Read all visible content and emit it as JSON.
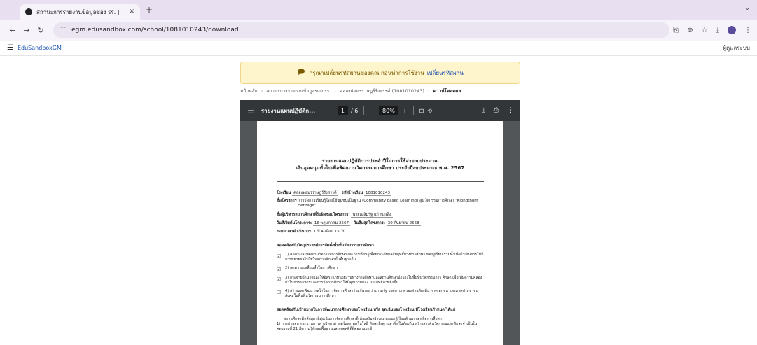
{
  "browser": {
    "tab_title": "สถานะการรายงานข้อมูลของ รร. |",
    "url": "egm.edusandbox.com/school/1081010243/download"
  },
  "app": {
    "brand": "EduSandboxGM",
    "user_menu": "ผู้ดูแลระบบ"
  },
  "notice": {
    "text": "กรุณาเปลี่ยนรหัสผ่านของคุณ ก่อนทำการใช้งาน",
    "link": "เปลี่ยนรหัสผ่าน"
  },
  "breadcrumb": [
    "หน้าหลัก",
    "สถานะการรายงานข้อมูลของ รร.",
    "คลองพ่อมรราษฎร์รังสรรค์ (1081010243)",
    "ดาวน์โหลดผล"
  ],
  "viewer": {
    "doc_title": "รายงานแผนปฏิบัติก...",
    "page_current": "1",
    "page_sep": "/",
    "page_total": "6",
    "zoom": "80%"
  },
  "doc": {
    "title_line1": "รายงานแผนปฏิบัติการประจำปีในการใช้จ่ายงบประมาณ",
    "title_line2": "เงินอุดหนุนทั่วไปเพื่อพัฒนานวัตกรรมการศึกษา ประจำปีงบประมาณ พ.ศ. 2567",
    "school_label": "โรงเรียน",
    "school_value": "คลองพ่อมรราษฎร์รังสรรค์",
    "code_label": "รหัสโรงเรียน",
    "code_value": "1081010243",
    "project_label": "ชื่อโครงการ",
    "project_value": "การจัดการเรียนรู้โดยใช้ชุมชนเป็นฐาน (Community based Learning) สู่นวัตกรรมการศึกษา \"Klongthom Heritage\"",
    "admin_label": "ชื่อผู้บริหารสถานศึกษาที่รับผิดชอบโครงการ:",
    "admin_value": "นายเฉลิมรัฐ แก้วนาเส็ง",
    "start_label": "วันที่เริ่มต้นโครงการ:",
    "start_value": "16 พฤษภาคม 2567",
    "end_label": "วันสิ้นสุดโครงการ:",
    "end_value": "30 กันยายน 2568",
    "duration_label": "ระยะเวลาดำเนินการ",
    "duration_value": "1 ปี 4 เดือน 15 วัน",
    "section1": "สอดคล้องกับวัตถุประสงค์การจัดตั้งพื้นที่นวัตกรรมการศึกษา",
    "checks": [
      "1) คิดค้นและพัฒนานวัตกรรมการศึกษาและการเรียนรู้เพื่อยกระดับผลสัมฤทธิ์ทางการศึกษา ของผู้เรียน รวมทั้งเพื่อดำเนินการให้มีการขยายผลไปใช้ในสถานศึกษาขั้นพื้นฐานอื่น",
      "2) ลดความเหลื่อมล้ำในการศึกษา",
      "3) กระจายอำนาจและให้อิสระแก่หน่วยงานทางการศึกษาและสถานศึกษานำร่องในพื้นที่นวัตกรรมการ ศึกษา เพื่อเพิ่มความคล่องตัวในการบริหารและการจัดการศึกษาให้มีคุณภาพและ ประสิทธิภาพยิ่งขึ้น",
      "4) สร้างและพัฒนากลไกในการจัดการศึกษาร่วมกันระหว่างภาครัฐ องค์กรปกครองส่วนท้องถิ่น ภาคเอกชน และภาคประชาชนสังคมในพื้นที่นวัตกรรมการศึกษา"
    ],
    "section2": "สอดคล้องกับเป้าหมายในการพัฒนาการศึกษาของโรงเรียน หรือ จุดเน้นของโรงเรียน ที่โรงเรียนกำหนด ได้แก่",
    "para": "สถานศึกษามีหลักสูตรที่มุ่งเน้นการจัดการศึกษาที่เน้นเสริมสร้างสมรรถนะผู้เรียนด้านภาษาเพื่อการสื่อสาร",
    "para_item": "1) การอ่านจบ กระบวนการทางวิทยาศาสตร์และเทคโนโลยี ทักษะพื้นฐานอาชีพในท้องถิ่น สร้างสรรค์นวัตกรรมและทักษะจำเป็นในศตวรรษที่ 21 มีความรู้ทักษะพื้นฐานและเจตคติที่ดีต่องานอาชี"
  }
}
